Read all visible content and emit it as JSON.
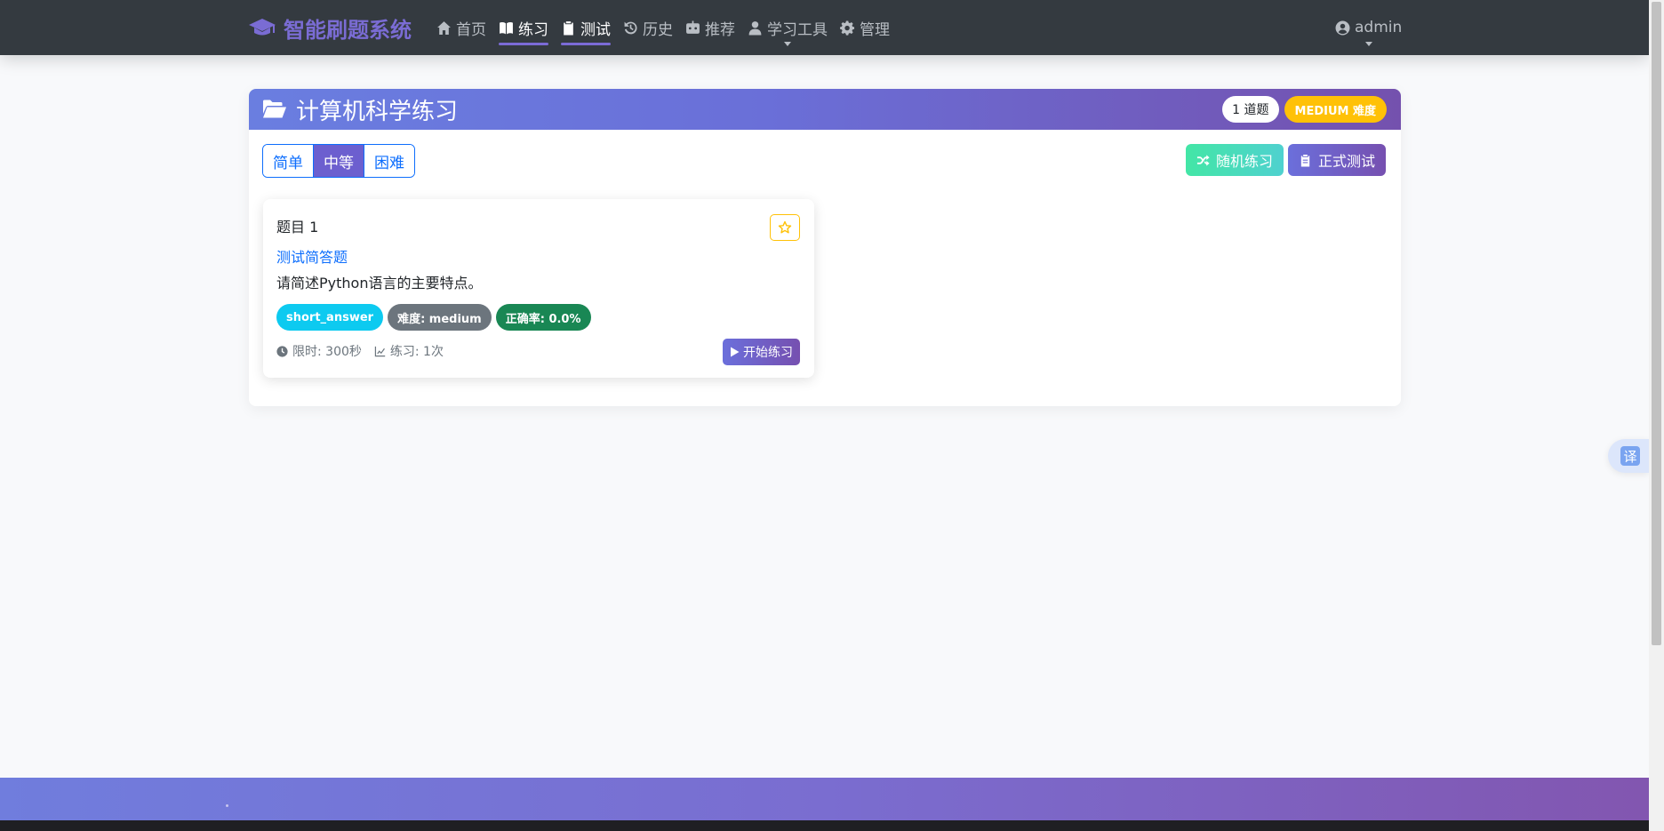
{
  "nav": {
    "brand": "智能刷题系统",
    "items": [
      {
        "label": "首页",
        "icon": "home-icon",
        "active": false
      },
      {
        "label": "练习",
        "icon": "book-icon",
        "active": true
      },
      {
        "label": "测试",
        "icon": "clipboard-icon",
        "active": true
      },
      {
        "label": "历史",
        "icon": "history-icon",
        "active": false
      },
      {
        "label": "推荐",
        "icon": "robot-icon",
        "active": false
      },
      {
        "label": "学习工具",
        "icon": "user-icon",
        "active": false,
        "dropdown": true
      },
      {
        "label": "管理",
        "icon": "gear-icon",
        "active": false
      }
    ],
    "user": "admin"
  },
  "card": {
    "title": "计算机科学练习",
    "count_badge": "1 道题",
    "difficulty_badge": "MEDIUM 难度",
    "filters": [
      {
        "label": "简单",
        "selected": false
      },
      {
        "label": "中等",
        "selected": true
      },
      {
        "label": "困难",
        "selected": false
      }
    ],
    "random_button": "随机练习",
    "test_button": "正式测试"
  },
  "question": {
    "number": "题目 1",
    "title": "测试简答题",
    "body": "请简述Python语言的主要特点。",
    "tags": {
      "type": "short_answer",
      "difficulty": "难度: medium",
      "accuracy": "正确率: 0.0%"
    },
    "time_limit": "限时: 300秒",
    "practice_count": "练习: 1次",
    "start_button": "开始练习"
  },
  "translate_label": "译",
  "colors": {
    "navbar": "#343a40",
    "brand": "#7a6cd4",
    "header_gradient_start": "#6a7ee0",
    "header_gradient_end": "#7451ae",
    "primary": "#0d6efd",
    "warning": "#ffc107",
    "info": "#0dcaf0",
    "success": "#198754",
    "secondary": "#6c757d"
  }
}
